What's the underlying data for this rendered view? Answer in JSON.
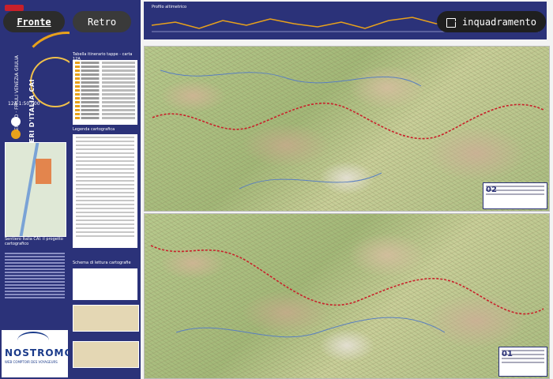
{
  "toolbar": {
    "front_label": "Fronte",
    "back_label": "Retro",
    "crop_label": "inquadramento",
    "active_side": "front"
  },
  "map": {
    "title_vertical": "SENTIERI D'ITALIA CAI",
    "region_vertical": "VENETO · FRIULI VENEZIA GIULIA",
    "sheet_number": "12A",
    "scale": "1:50.000",
    "publisher": "NOSTROMO",
    "publisher_tag": "WEB COMPTOIR DES VOYAGEURS",
    "profile_title": "Profilo altimetrico",
    "table_title": "Tabella itinerario tappe - carta 12A",
    "legend_title": "Legenda cartografica",
    "project_title": "Sentiero Italia CAI: il progetto cartografico",
    "scheme_title": "Schema di lettura cartografie",
    "panel_top_number": "02",
    "panel_bottom_number": "01"
  },
  "colors": {
    "navy": "#2b3279",
    "accent": "#e8a11b",
    "route": "#c8202a"
  }
}
